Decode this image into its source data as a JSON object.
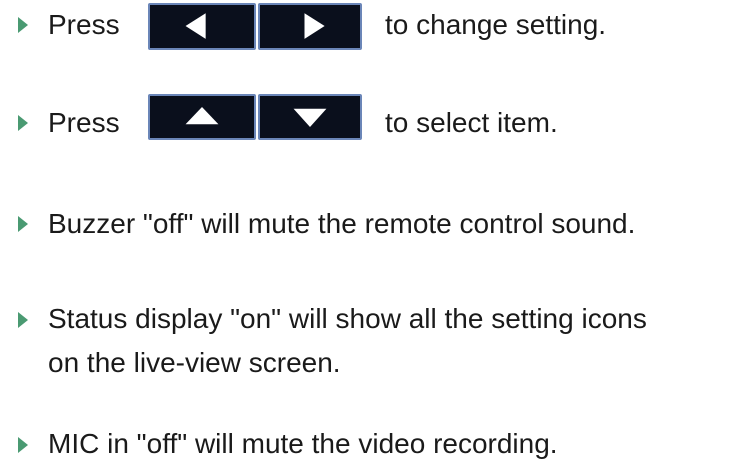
{
  "instructions": [
    {
      "prefix": "Press",
      "suffix": "to change setting.",
      "keys": [
        "left-arrow",
        "right-arrow"
      ]
    },
    {
      "prefix": "Press",
      "suffix": "to select item.",
      "keys": [
        "up-arrow",
        "down-arrow"
      ]
    },
    {
      "text": "Buzzer \"off\" will mute the remote control sound."
    },
    {
      "text_line1": "Status display \"on\" will show all the setting icons",
      "text_line2": "on the live-view screen."
    },
    {
      "text": "MIC in \"off\" will mute the video recording."
    }
  ],
  "colors": {
    "bullet": "#4a9a72",
    "key_background": "#0a0f1c",
    "key_border": "#6b86b8",
    "key_arrow": "#ffffff"
  }
}
